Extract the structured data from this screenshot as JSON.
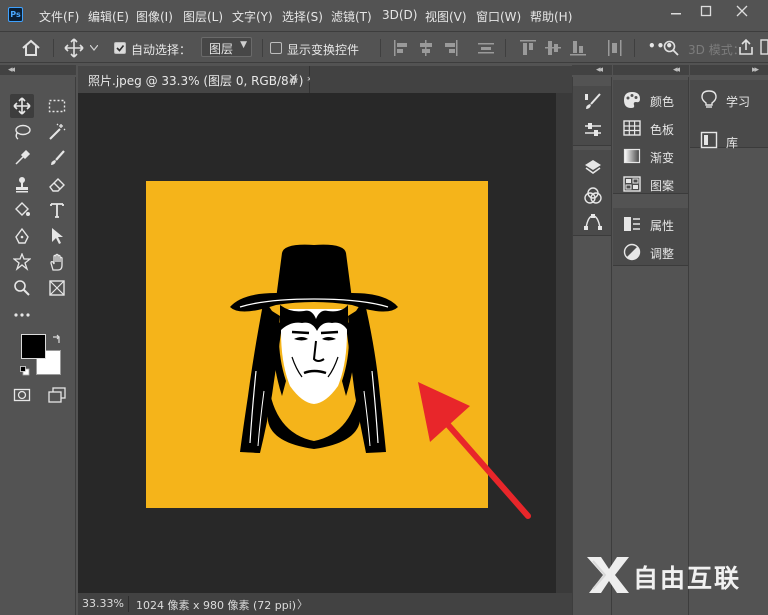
{
  "app": {
    "logo": "Ps"
  },
  "menu": [
    "文件(F)",
    "编辑(E)",
    "图像(I)",
    "图层(L)",
    "文字(Y)",
    "选择(S)",
    "滤镜(T)",
    "3D(D)",
    "视图(V)",
    "窗口(W)",
    "帮助(H)"
  ],
  "window_controls": [
    "minimize-icon",
    "restore-icon",
    "close-icon"
  ],
  "options": {
    "auto_select_label": "自动选择：",
    "auto_select_checked": true,
    "layer_select_value": "图层",
    "show_transform_label": "显示变换控件",
    "show_transform_checked": false,
    "mode_3d_label": "3D 模式："
  },
  "document": {
    "tab_title": "照片.jpeg @ 33.3% (图层 0, RGB/8#) *",
    "close_glyph": "×",
    "canvas_color": "#f5b41a"
  },
  "status": {
    "zoom": "33.33%",
    "size": "1024 像素 x 980 像素 (72 ppi)",
    "chevron": "〉"
  },
  "colors": {
    "foreground": "#000000",
    "background": "#ffffff",
    "arrow": "#e8262a"
  },
  "panels": {
    "column2": [
      {
        "icon": "palette-icon",
        "label": "颜色"
      },
      {
        "icon": "grid-icon",
        "label": "色板"
      },
      {
        "icon": "gradient-icon",
        "label": "渐变"
      },
      {
        "icon": "pattern-icon",
        "label": "图案"
      },
      {
        "icon": "properties-icon",
        "label": "属性"
      },
      {
        "icon": "adjustments-icon",
        "label": "调整"
      }
    ],
    "column3": [
      {
        "icon": "lightbulb-icon",
        "label": "学习"
      },
      {
        "icon": "library-icon",
        "label": "库"
      }
    ]
  },
  "watermark": {
    "text": "自由互联"
  }
}
